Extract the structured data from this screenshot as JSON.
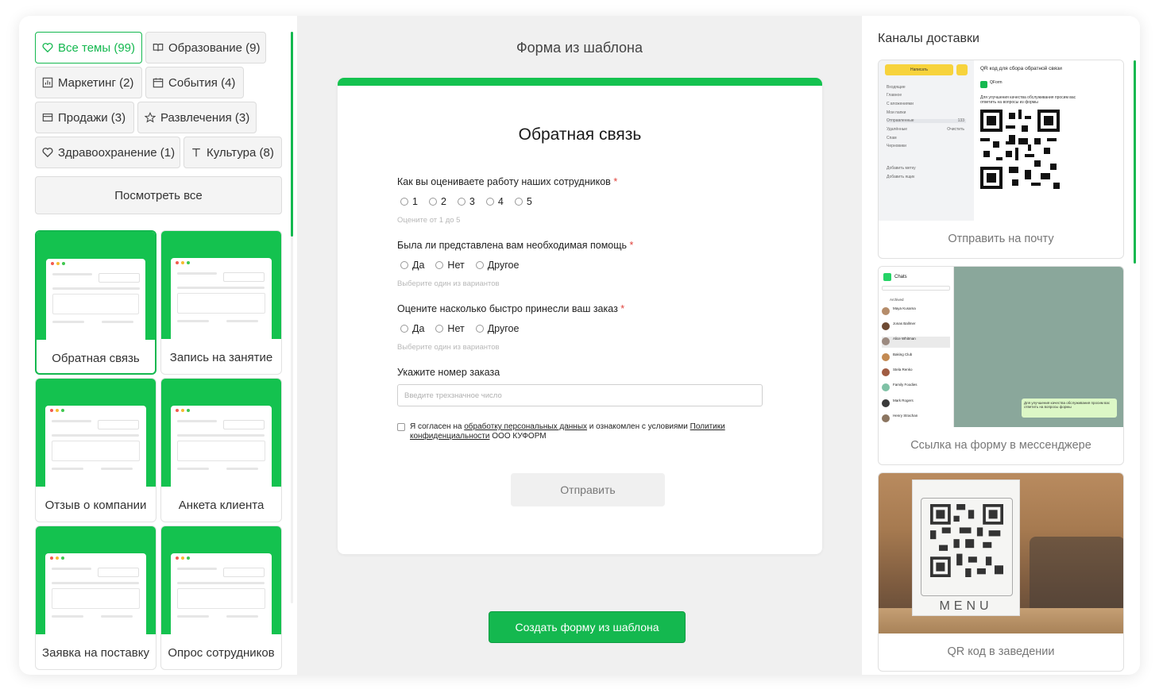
{
  "left": {
    "chips": [
      {
        "label": "Все темы (99)",
        "icon": "heart-icon"
      },
      {
        "label": "Образование (9)",
        "icon": "book-icon"
      },
      {
        "label": "Маркетинг (2)",
        "icon": "chart-icon"
      },
      {
        "label": "События (4)",
        "icon": "calendar-icon"
      },
      {
        "label": "Продажи (3)",
        "icon": "card-icon"
      },
      {
        "label": "Развлечения (3)",
        "icon": "star-icon"
      },
      {
        "label": "Здравоохранение (1)",
        "icon": "heart-icon"
      },
      {
        "label": "Культура (8)",
        "icon": "text-icon"
      }
    ],
    "view_all": "Посмотреть все",
    "templates": [
      {
        "label": "Обратная связь"
      },
      {
        "label": "Запись на занятие"
      },
      {
        "label": "Отзыв о компании"
      },
      {
        "label": "Анкета клиента"
      },
      {
        "label": "Заявка на поставку"
      },
      {
        "label": "Опрос сотрудников"
      }
    ]
  },
  "center": {
    "title": "Форма из шаблона",
    "form": {
      "title": "Обратная связь",
      "q1": {
        "text": "Как вы оцениваете работу наших сотрудников",
        "options": [
          "1",
          "2",
          "3",
          "4",
          "5"
        ],
        "hint": "Оцените от 1 до 5"
      },
      "q2": {
        "text": "Была ли представлена вам необходимая помощь",
        "options": [
          "Да",
          "Нет",
          "Другое"
        ],
        "hint": "Выберите один из вариантов"
      },
      "q3": {
        "text": "Оцените насколько быстро принесли ваш заказ",
        "options": [
          "Да",
          "Нет",
          "Другое"
        ],
        "hint": "Выберите один из вариантов"
      },
      "q4": {
        "text": "Укажите номер заказа",
        "placeholder": "Введите трехзначное число"
      },
      "required_mark": "*",
      "consent": {
        "part1": "Я согласен на ",
        "link1": "обработку персональных данных",
        "part2": " и ознакомлен с условиями ",
        "link2": "Политики конфиденциальности",
        "part3": " ООО КУФОРМ"
      },
      "submit": "Отправить"
    },
    "create_button": "Создать форму из шаблона"
  },
  "right": {
    "title": "Каналы доставки",
    "channels": [
      {
        "label": "Отправить на почту"
      },
      {
        "label": "Ссылка на форму в мессенджере"
      },
      {
        "label": "QR код в заведении"
      }
    ],
    "mail": {
      "compose": "Написать",
      "folders": [
        "Входящие",
        "Главное",
        "С вложениями",
        "Мои папки",
        "Отправленные",
        "Удалённые",
        "Спам",
        "Черновики",
        "Добавить метку",
        "Добавить ящик"
      ],
      "sent_count": "133",
      "clean": "Очистить",
      "subject": "QR код для сбора обратной связи",
      "from": "QForm",
      "body": "Для улучшения качества обслуживания просим вас ответить на вопросы из формы"
    },
    "messenger": {
      "header": "Chats",
      "archived": "Archived",
      "chats": [
        "Maya Kusama",
        "Jonas Ballmer",
        "Alice Whitman",
        "Baking Club",
        "Stela Renko",
        "Family Foodies",
        "Mark Rogers",
        "Henry Strachan"
      ],
      "bubble": "Для улучшения качества обслуживания просим вас ответить на вопросы формы"
    },
    "menu_sign": "MENU"
  },
  "colors": {
    "accent": "#14b84f",
    "required": "#e0433c"
  }
}
